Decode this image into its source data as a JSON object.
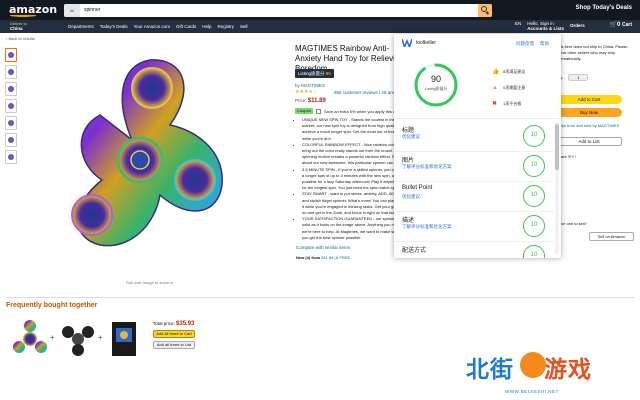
{
  "header": {
    "logo": "amazon",
    "search_category": "All",
    "search_value": "spinner",
    "deals": "Shop Today's Deals"
  },
  "navbar": {
    "deliver_line1": "Deliver to",
    "deliver_line2": "China",
    "links": [
      "Departments",
      "Today's Deals",
      "Your Amazon.com",
      "Gift Cards",
      "Help",
      "Registry",
      "Sell"
    ],
    "lang": "EN",
    "account_line1": "Hello, Sign in",
    "account_line2": "Accounts & Lists",
    "orders": "Orders",
    "cart_count": "0",
    "cart": "Cart"
  },
  "back_link": "‹ Back to results",
  "product": {
    "title": "MAGTIMES Rainbow Anti-Anxiety Hand Toy for Relieving Boredom",
    "choice_label": "Listing质量分",
    "choice_score": "90",
    "brand": "by MAGTIMES",
    "stars": "★★★★☆",
    "ratings": "856 customer reviews | 25 answered questions",
    "price_label": "Price:",
    "price": "$11.89",
    "coupon_badge": "Coupon",
    "coupon_text": "Save an extra 5% when you apply this coupon.",
    "bullets": [
      "UNIQUE NEW SPIN TOY - Stands the coolest in the market, our new spin toy is designed from high quality to achieve a much longer spin. Get the most out of free spins while you're at it.",
      "COLORFUL RAINBOW EFFECT - Nice rainbow color bring out the color really stands out from the crowd. The spinning motion creates a powerful rainbow effect. Read about our new awesome, this particular spinner can get.",
      "3-5 MINUTE SPIN - If you're a skilled spinner, you can get a longer spin of up to 3 minutes with the new spin, and possible for a lazy Saturday afternoon! Play it anywhere for the longest spin. You just need the spin-match app.",
      "STAY SMART - want to put stress, anxiety, ADD, ADHD and stylish fidget spinner. What's more! You can play with it while you're engaged in thinking tasks. Get your game on and get in the Zone, and focus in right on that task.",
      "YOUR SATISFACTION GUARANTEED - our spinner is as solid as it looks on the image above. Anything you need, we're here to help. At Magtimes, we want to make sure you get the best spinner possible."
    ],
    "compare": "Compare with similar items",
    "newfrom_label": "New (4) from",
    "newfrom_price": "$11.89 (& FREE..."
  },
  "image_caption": "Roll over image to zoom in",
  "buybox": {
    "text": "This item does not ship to China. Please check other sellers who may ship internationally.",
    "qty_label": "Qty:",
    "qty_value": "1",
    "add_to_cart": "Add to Cart",
    "buy_now": "Buy Now",
    "fulfilled": "Ships from and sold by MAGTIMES",
    "add_to_list": "Add to List",
    "share": "Share",
    "other_sellers": "Have one to sell?",
    "sell_btn": "Sell on Amazon"
  },
  "fbt": {
    "title": "Frequently bought together",
    "total_label": "Total price:",
    "total": "$35.93",
    "btn_cart": "Add all three to Cart",
    "btn_list": "Add all three to List"
  },
  "extension": {
    "name": "toolkeller",
    "link1": "问题反馈",
    "link2": "帮助",
    "score": "90",
    "score_label": "Listing质量分",
    "stats": [
      {
        "icon": "thumbs-up-icon",
        "text": "8项满足建议",
        "color": "#2a6be0"
      },
      {
        "icon": "warning-icon",
        "text": "0项需要注意",
        "color": "#f5a623"
      },
      {
        "icon": "error-icon",
        "text": "1项不合格",
        "color": "#e5322d"
      }
    ],
    "checks": [
      {
        "title": "标题",
        "link": "优化建议",
        "score": "10"
      },
      {
        "title": "图片",
        "link": "了解评分标准和优化方案",
        "score": "10"
      },
      {
        "title": "Bullet Point",
        "link": "优化建议",
        "score": "10"
      },
      {
        "title": "描述",
        "link": "了解评分标准和优化方案",
        "score": "10"
      },
      {
        "title": "配送方式",
        "link": "",
        "score": "10"
      }
    ]
  },
  "watermark": {
    "blue": "北街",
    "orange": "游戏",
    "url": "WWW.BEIJIESHI.NET"
  },
  "colors": {
    "amazon_dark": "#131921",
    "amazon_nav": "#232f3e",
    "amazon_orange": "#ff9900",
    "link": "#007185",
    "price": "#b12704",
    "ext_green": "#34c759",
    "ext_blue": "#2a6be0"
  }
}
